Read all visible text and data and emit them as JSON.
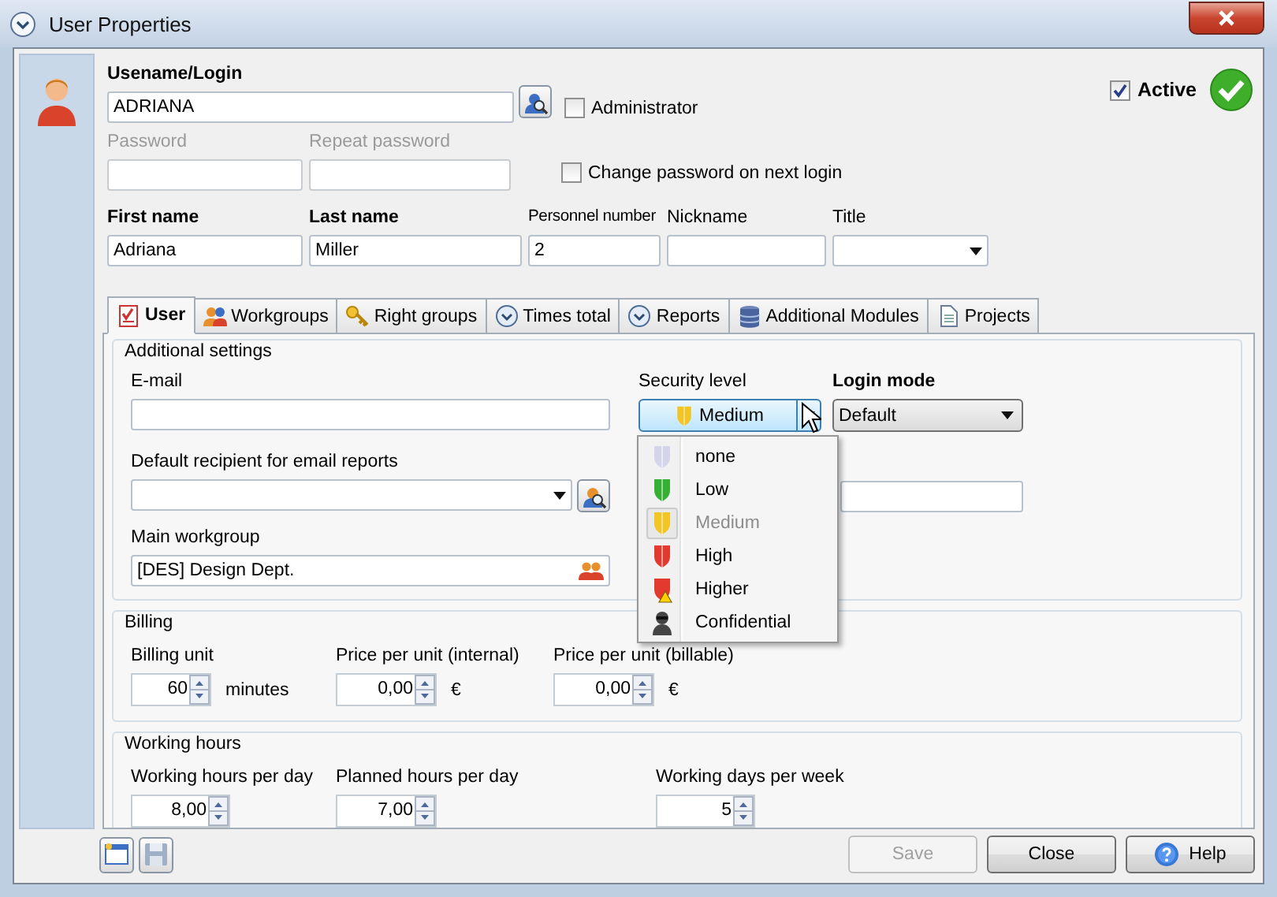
{
  "window": {
    "title": "User Properties"
  },
  "login": {
    "label": "Usename/Login",
    "value": "ADRIANA"
  },
  "administrator": {
    "label": "Administrator",
    "checked": false
  },
  "active": {
    "label": "Active",
    "checked": true
  },
  "password_fields": [
    {
      "label": "Password",
      "disabled": true
    },
    {
      "label": "Repeat password",
      "disabled": true
    }
  ],
  "change_password": {
    "label": "Change password on next login",
    "checked": false
  },
  "person_fields": [
    {
      "kind": "text",
      "label": "First name",
      "required": true,
      "value": "Adriana"
    },
    {
      "kind": "text",
      "label": "Last name",
      "required": true,
      "value": "Miller"
    },
    {
      "kind": "text",
      "label": "Personnel number",
      "required": false,
      "value": "2"
    },
    {
      "kind": "text",
      "label": "Nickname",
      "required": false
    },
    {
      "kind": "select",
      "label": "Title",
      "required": false
    }
  ],
  "tabs": [
    {
      "label": "User",
      "selected": true
    },
    {
      "label": "Workgroups",
      "selected": false
    },
    {
      "label": "Right groups",
      "selected": false
    },
    {
      "label": "Times total",
      "selected": false
    },
    {
      "label": "Reports",
      "selected": false
    },
    {
      "label": "Additional Modules",
      "selected": false
    },
    {
      "label": "Projects",
      "selected": false
    }
  ],
  "additional_settings": {
    "title": "Additional settings",
    "email": {
      "label": "E-mail"
    },
    "security_level": {
      "label": "Security level",
      "value": "Medium"
    },
    "login_mode": {
      "label": "Login mode",
      "value": "Default"
    },
    "default_recipient": {
      "label": "Default recipient for email reports"
    },
    "main_workgroup": {
      "label": "Main workgroup",
      "value": "[DES] Design Dept."
    }
  },
  "security_menu": [
    {
      "label": "none",
      "kind": "shield",
      "color": "#d4d4ea",
      "selected": false
    },
    {
      "label": "Low",
      "kind": "shield",
      "color": "#35b035",
      "selected": false
    },
    {
      "label": "Medium",
      "kind": "shield",
      "color": "#f2c424",
      "selected": true
    },
    {
      "label": "High",
      "kind": "shield",
      "color": "#e23a2e",
      "selected": false
    },
    {
      "label": "Higher",
      "kind": "shield-warning",
      "color": "#e23a2e",
      "selected": false
    },
    {
      "label": "Confidential",
      "kind": "agent",
      "color": "#454545",
      "selected": false
    }
  ],
  "billing": {
    "title": "Billing",
    "fields": [
      {
        "label": "Billing unit",
        "value": "60",
        "unit": "minutes"
      },
      {
        "label": "Price per unit (internal)",
        "value": "0,00",
        "unit": "€"
      },
      {
        "label": "Price per unit (billable)",
        "value": "0,00",
        "unit": "€"
      }
    ]
  },
  "working_hours": {
    "title": "Working hours",
    "fields": [
      {
        "label": "Working hours per day",
        "value": "8,00"
      },
      {
        "label": "Planned hours per day",
        "value": "7,00"
      },
      {
        "label": "Working days per week",
        "value": "5"
      }
    ]
  },
  "buttons": [
    {
      "label": "Save",
      "kind": "plain",
      "disabled": true
    },
    {
      "label": "Close",
      "kind": "plain",
      "disabled": false
    },
    {
      "label": "Help",
      "kind": "help",
      "disabled": false
    }
  ]
}
